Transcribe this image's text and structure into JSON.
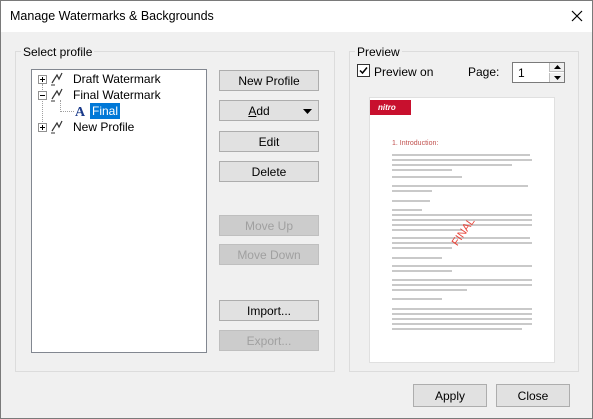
{
  "window": {
    "title": "Manage Watermarks & Backgrounds",
    "close_glyph": "✕"
  },
  "select_profile": {
    "label": "Select profile",
    "tree": [
      {
        "label": "Draft Watermark",
        "expander": "+"
      },
      {
        "label": "Final Watermark",
        "expander": "−"
      },
      {
        "label": "Final",
        "selected": true
      },
      {
        "label": "New Profile",
        "expander": "+"
      }
    ]
  },
  "buttons": {
    "new_profile": "New Profile",
    "add": "Add",
    "edit": "Edit",
    "delete": "Delete",
    "move_up": "Move Up",
    "move_down": "Move Down",
    "import": "Import...",
    "export": "Export...",
    "apply": "Apply",
    "close": "Close"
  },
  "preview": {
    "label": "Preview",
    "checkbox_label": "Preview on",
    "checked": true,
    "page_label": "Page:",
    "page_value": "1",
    "doc_logo": "nitro",
    "doc_heading": "1. Introduction:",
    "doc_watermark": "FINAL"
  },
  "colors": {
    "selection": "#0078d7",
    "logo_red": "#c8102e",
    "watermark_red": "#e8443a"
  }
}
